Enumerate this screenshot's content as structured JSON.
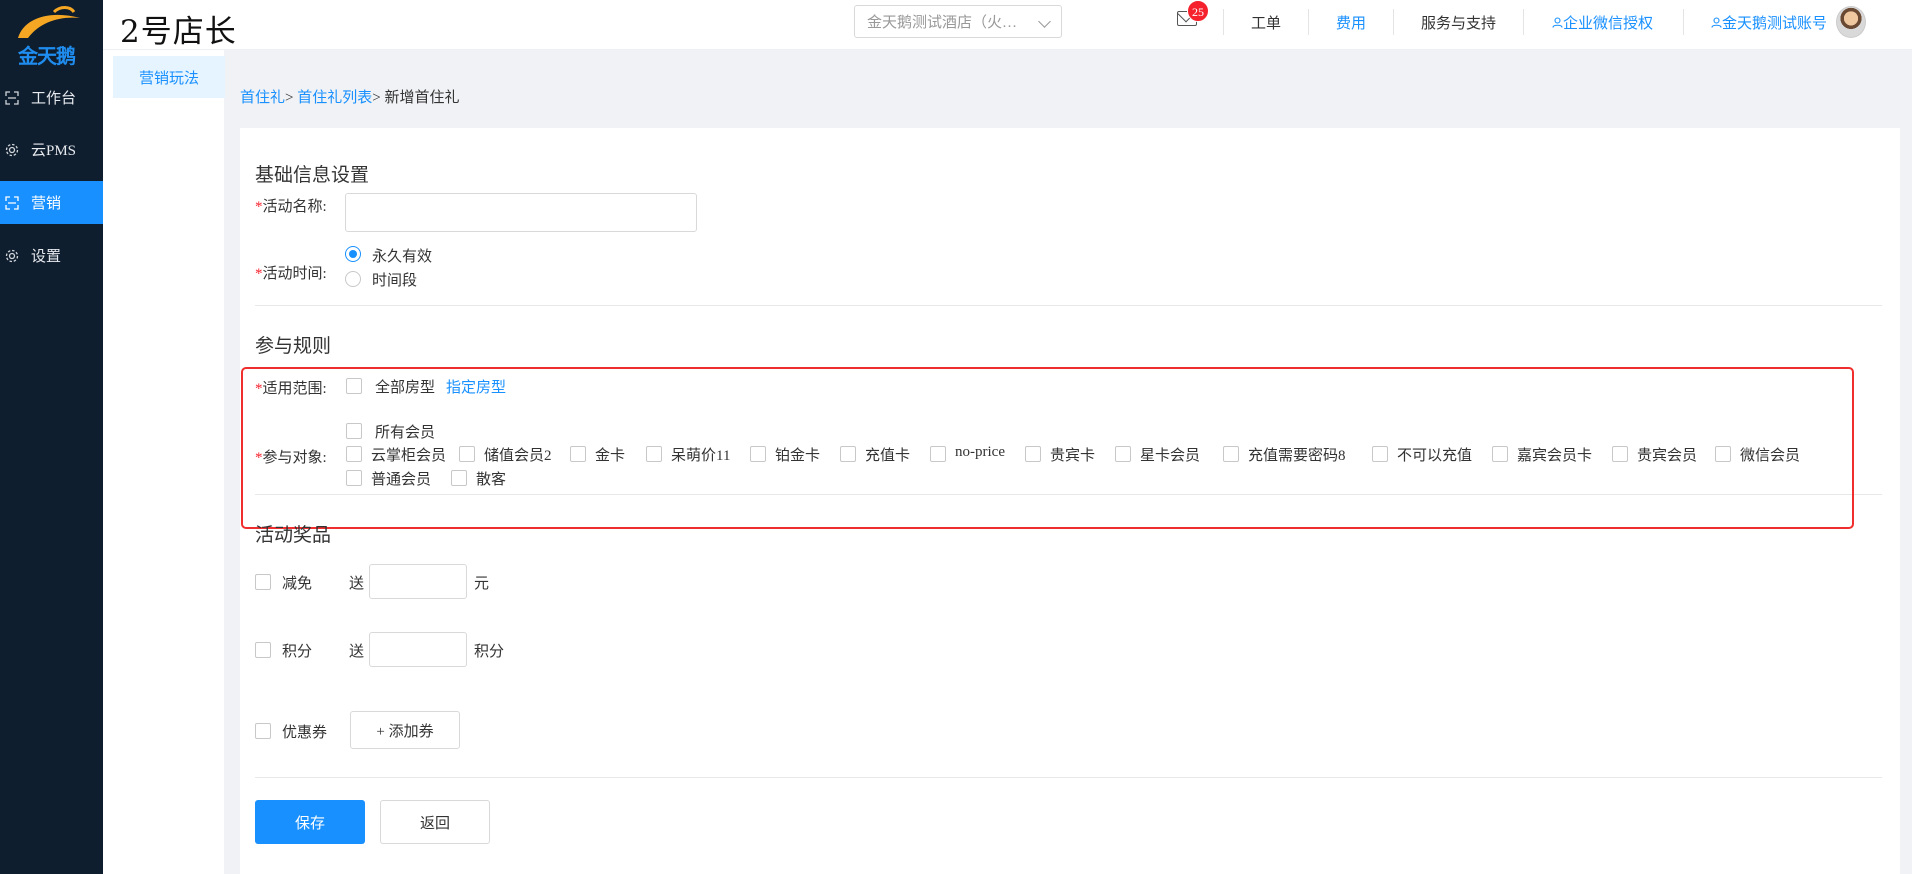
{
  "sidebar": {
    "logo_text": "金天鹅",
    "items": [
      {
        "label": "工作台"
      },
      {
        "label": "云PMS"
      },
      {
        "label": "营销"
      },
      {
        "label": "设置"
      }
    ]
  },
  "header": {
    "brand": "2号店长",
    "hotel_select": "金天鹅测试酒店（火…",
    "mail_badge": "25",
    "links": {
      "workorder": "工单",
      "fees": "费用",
      "support": "服务与支持",
      "wechat_auth": "企业微信授权",
      "account": "金天鹅测试账号"
    }
  },
  "submenu": {
    "item": "营销玩法"
  },
  "breadcrumb": {
    "level1": "首住礼",
    "level2": "首住礼列表",
    "current": "新增首住礼",
    "sep": ">"
  },
  "basic": {
    "title": "基础信息设置",
    "name_label": "活动名称:",
    "name_value": "",
    "time_label": "活动时间:",
    "time_options": [
      "永久有效",
      "时间段"
    ],
    "time_selected": 0
  },
  "rules": {
    "title": "参与规则",
    "scope_label": "适用范围:",
    "scope_all": "全部房型",
    "scope_specific": "指定房型",
    "target_label": "参与对象:",
    "all_members": "所有会员",
    "members": [
      "云掌柜会员",
      "储值会员2",
      "金卡",
      "呆萌价11",
      "铂金卡",
      "充值卡",
      "no-price",
      "贵宾卡",
      "星卡会员",
      "充值需要密码8",
      "不可以充值",
      "嘉宾会员卡",
      "贵宾会员",
      "微信会员"
    ],
    "members_row2": [
      "普通会员",
      "散客"
    ]
  },
  "prizes": {
    "title": "活动奖品",
    "reduce_label": "减免",
    "give": "送",
    "reduce_unit": "元",
    "points_label": "积分",
    "points_unit": "积分",
    "coupon_label": "优惠券",
    "add_coupon": "+ 添加券"
  },
  "actions": {
    "save": "保存",
    "back": "返回"
  },
  "colors": {
    "primary": "#1890ff",
    "sidebar": "#0f1e2e",
    "required": "#f5222d",
    "highlight": "#f02e2e"
  }
}
